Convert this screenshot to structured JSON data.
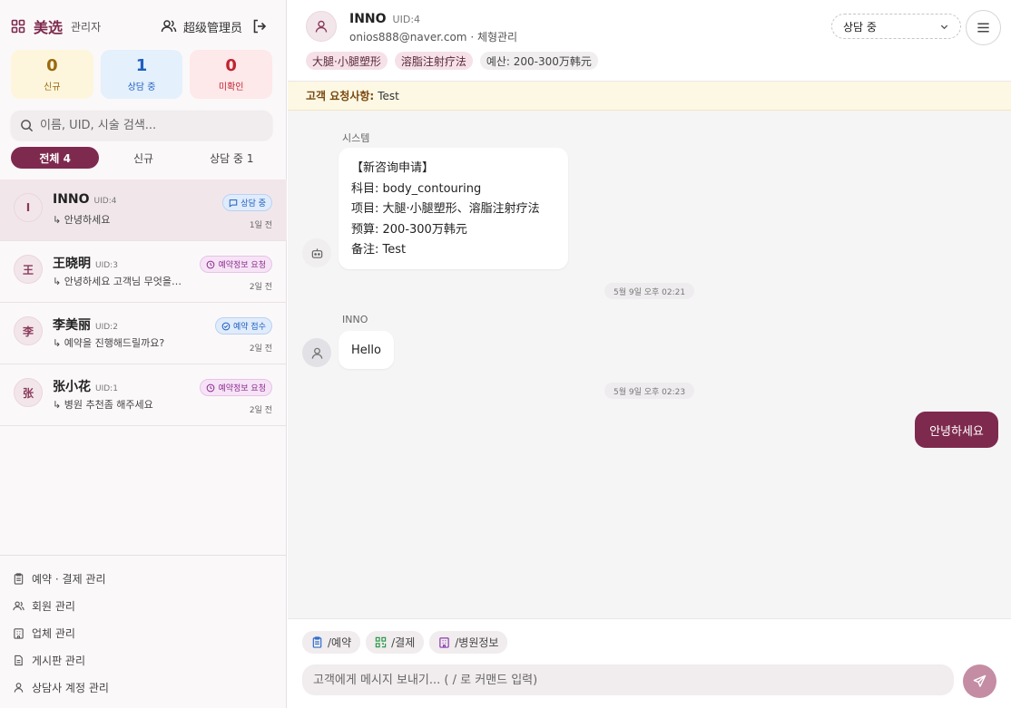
{
  "brand": {
    "name": "美选",
    "role": "관리자"
  },
  "admin": {
    "label": "超级管理员"
  },
  "stats": {
    "new": {
      "count": "0",
      "label": "신규"
    },
    "talking": {
      "count": "1",
      "label": "상담 중"
    },
    "unread": {
      "count": "0",
      "label": "미확인"
    }
  },
  "search": {
    "placeholder": "이름, UID, 시술 검색..."
  },
  "filters": [
    "전체 4",
    "신규",
    "상담 중 1"
  ],
  "conversations": [
    {
      "initial": "I",
      "name": "INNO",
      "uid": "UID:4",
      "preview": "↳ 안녕하세요",
      "badge": "상담 중",
      "time": "1일 전"
    },
    {
      "initial": "王",
      "name": "王晓明",
      "uid": "UID:3",
      "preview": "↳ 안녕하세요 고객님 무엇을…",
      "badge": "예약정보 요청",
      "time": "2일 전"
    },
    {
      "initial": "李",
      "name": "李美丽",
      "uid": "UID:2",
      "preview": "↳ 예약을 진행해드릴까요?",
      "badge": "예약 접수",
      "time": "2일 전"
    },
    {
      "initial": "张",
      "name": "张小花",
      "uid": "UID:1",
      "preview": "↳ 병원 추천좀 해주세요",
      "badge": "예약정보 요청",
      "time": "2일 전"
    }
  ],
  "menu": [
    "예약 · 결제 관리",
    "회원 관리",
    "업체 관리",
    "게시판 관리",
    "상담사 계정 관리"
  ],
  "header": {
    "name": "INNO",
    "uid": "UID:4",
    "sub": "onios888@naver.com · 체형관리",
    "tags": [
      "大腿·小腿塑形",
      "溶脂注射疗法",
      "예산: 200-300万韩元"
    ],
    "status": "상담 중"
  },
  "notice": {
    "label": "고객 요청사항:",
    "text": "Test"
  },
  "chat": {
    "system_label": "시스템",
    "system_lines": [
      "【新咨询申请】",
      "科目: body_contouring",
      "项目: 大腿·小腿塑形、溶脂注射疗法",
      "预算: 200-300万韩元",
      "备注: Test"
    ],
    "time1": "5월 9일 오후 02:21",
    "user_label": "INNO",
    "user_msg": "Hello",
    "time2": "5월 9일 오후 02:23",
    "my_msg": "안녕하세요"
  },
  "commands": [
    "/예약",
    "/결제",
    "/병원정보"
  ],
  "composer": {
    "placeholder": "고객에게 메시지 보내기... ( / 로 커맨드 입력)"
  },
  "colors": {
    "accent": "#7e2a4e",
    "notice_bg": "#fdf8e4",
    "send_bg": "#c48da3"
  }
}
